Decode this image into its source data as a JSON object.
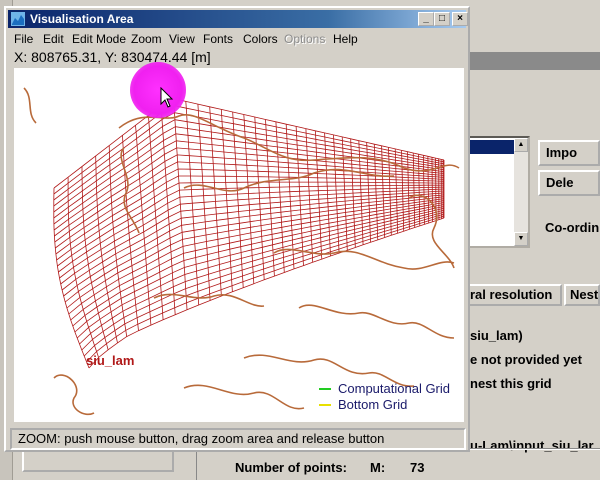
{
  "window": {
    "title": "Visualisation Area",
    "controls": {
      "minimize": "_",
      "maximize": "□",
      "close": "×"
    }
  },
  "menu": [
    {
      "label": "File",
      "enabled": true
    },
    {
      "label": "Edit",
      "enabled": true
    },
    {
      "label": "Edit Mode",
      "enabled": true
    },
    {
      "label": "Zoom",
      "enabled": true
    },
    {
      "label": "View",
      "enabled": true
    },
    {
      "label": "Fonts",
      "enabled": true
    },
    {
      "label": "Colors",
      "enabled": true
    },
    {
      "label": "Options",
      "enabled": false
    },
    {
      "label": "Help",
      "enabled": true
    }
  ],
  "coords": "X:    808765.31,    Y:    830474.44 [m]",
  "canvas": {
    "region_label": "siu_lam",
    "legend": [
      {
        "label": "Computational Grid",
        "color": "#22cc22"
      },
      {
        "label": "Bottom Grid",
        "color": "#e8e000"
      }
    ],
    "grid_color": "#b01818",
    "coast_color": "#b86a3a"
  },
  "status": "ZOOM: push mouse button, drag zoom area and release button",
  "background": {
    "buttons": [
      "Impo",
      "Dele"
    ],
    "coord_label": "Co-ordin",
    "tabs": [
      "ral resolution",
      "Nest"
    ],
    "lines": [
      "siu_lam)",
      "e not provided yet",
      "nest this grid",
      "u-Lam\\input_siu_lar"
    ],
    "points_label": "Number of points:",
    "points_m": "M:",
    "points_value": "73"
  }
}
